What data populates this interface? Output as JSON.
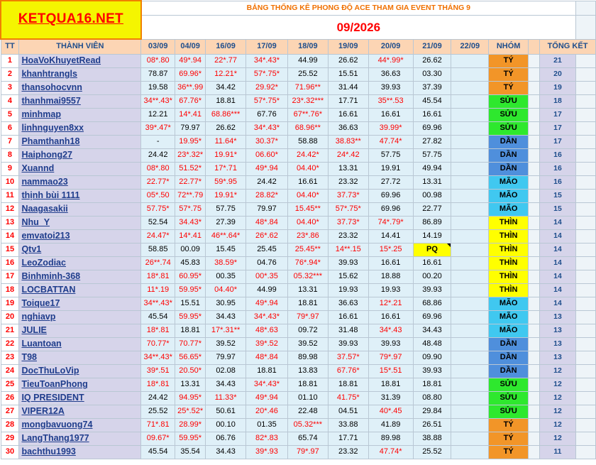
{
  "logo": "KETQUA16.NET",
  "title": "BẢNG THỐNG KÊ PHONG ĐỘ ACE THAM GIA EVENT THÁNG 9",
  "period": "09/2026",
  "headers": {
    "tt": "TT",
    "member": "THÀNH VIÊN",
    "dates": [
      "03/09",
      "04/09",
      "16/09",
      "17/09",
      "18/09",
      "19/09",
      "20/09",
      "21/09",
      "22/09"
    ],
    "group": "NHÓM",
    "total": "TỔNG KẾT"
  },
  "group_colors": {
    "TÝ": "#f29528",
    "SỬU": "#2ee82e",
    "DẦN": "#4f8fdc",
    "MÃO": "#40c8f0",
    "THÌN": "#ffff00"
  },
  "rows": [
    {
      "tt": "1",
      "name": "HoaVoKhuyetRead",
      "vals": [
        "08*.80",
        "49*.94",
        "22*.77",
        "34*.43*",
        "44.99",
        "26.62",
        "44*.99*",
        "26.62",
        ""
      ],
      "group": "TÝ",
      "total": "21"
    },
    {
      "tt": "2",
      "name": "khanhtrangls",
      "vals": [
        "78.87",
        "69.96*",
        "12.21*",
        "57*.75*",
        "25.52",
        "15.51",
        "36.63",
        "03.30",
        ""
      ],
      "group": "TÝ",
      "total": "20"
    },
    {
      "tt": "3",
      "name": "thansohocvnn",
      "vals": [
        "19.58",
        "36**.99",
        "34.42",
        "29.92*",
        "71.96**",
        "31.44",
        "39.93",
        "37.39",
        ""
      ],
      "group": "TÝ",
      "total": "19"
    },
    {
      "tt": "4",
      "name": "thanhmai9557",
      "vals": [
        "34**.43*",
        "67.76*",
        "18.81",
        "57*.75*",
        "23*.32***",
        "17.71",
        "35**.53",
        "45.54",
        ""
      ],
      "group": "SỬU",
      "total": "18"
    },
    {
      "tt": "5",
      "name": "minhmap",
      "vals": [
        "12.21",
        "14*.41",
        "68.86***",
        "67.76",
        "67**.76*",
        "16.61",
        "16.61",
        "16.61",
        ""
      ],
      "group": "SỬU",
      "total": "17"
    },
    {
      "tt": "6",
      "name": "linhnguyen8xx",
      "vals": [
        "39*.47*",
        "79.97",
        "26.62",
        "34*.43*",
        "68.96**",
        "36.63",
        "39.99*",
        "69.96",
        ""
      ],
      "group": "SỬU",
      "total": "17"
    },
    {
      "tt": "7",
      "name": "Phamthanh18",
      "vals": [
        "-",
        "19.95*",
        "11.64*",
        "30.37*",
        "58.88",
        "38.83**",
        "47.74*",
        "27.82",
        ""
      ],
      "group": "DẦN",
      "total": "17"
    },
    {
      "tt": "8",
      "name": "Haiphong27",
      "vals": [
        "24.42",
        "23*.32*",
        "19.91*",
        "06.60*",
        "24.42*",
        "24*.42",
        "57.75",
        "57.75",
        ""
      ],
      "group": "DẦN",
      "total": "16"
    },
    {
      "tt": "9",
      "name": "Xuannd",
      "vals": [
        "08*.80",
        "51.52*",
        "17*.71",
        "49*.94",
        "04.40*",
        "13.31",
        "19.91",
        "49.94",
        ""
      ],
      "group": "DẦN",
      "total": "16"
    },
    {
      "tt": "10",
      "name": "nammao23",
      "vals": [
        "22.77*",
        "22.77*",
        "59*.95",
        "24.42",
        "16.61",
        "23.32",
        "27.72",
        "13.31",
        ""
      ],
      "group": "MÃO",
      "total": "16"
    },
    {
      "tt": "11",
      "name": "thịnh bùi 1111",
      "vals": [
        "05*.50",
        "72**.79",
        "19.91*",
        "28.82*",
        "04.40*",
        "37.73*",
        "69.96",
        "00.98",
        ""
      ],
      "group": "MÃO",
      "total": "15"
    },
    {
      "tt": "12",
      "name": "Naagasakii",
      "vals": [
        "57.75*",
        "57*.75",
        "57.75",
        "79.97",
        "15.45**",
        "57*.75*",
        "69.96",
        "22.77",
        ""
      ],
      "group": "MÃO",
      "total": "15"
    },
    {
      "tt": "13",
      "name": "Nhu_Y",
      "vals": [
        "52.54",
        "34.43*",
        "27.39",
        "48*.84",
        "04.40*",
        "37.73*",
        "74*.79*",
        "86.89",
        ""
      ],
      "group": "THÌN",
      "total": "14"
    },
    {
      "tt": "14",
      "name": "emvatoi213",
      "vals": [
        "24.47*",
        "14*.41",
        "46**.64*",
        "26*.62",
        "23*.86",
        "23.32",
        "14.41",
        "14.19",
        ""
      ],
      "group": "THÌN",
      "total": "14"
    },
    {
      "tt": "15",
      "name": "Qtv1",
      "vals": [
        "58.85",
        "00.09",
        "15.45",
        "25.45",
        "25.45**",
        "14**.15",
        "15*.25",
        "PQ",
        ""
      ],
      "group": "THÌN",
      "total": "14"
    },
    {
      "tt": "16",
      "name": "LeoZodiac",
      "vals": [
        "26**.74",
        "45.83",
        "38.59*",
        "04.76",
        "76*.94*",
        "39.93",
        "16.61",
        "16.61",
        ""
      ],
      "group": "THÌN",
      "total": "14"
    },
    {
      "tt": "17",
      "name": "Binhminh-368",
      "vals": [
        "18*.81",
        "60.95*",
        "00.35",
        "00*.35",
        "05.32***",
        "15.62",
        "18.88",
        "00.20",
        ""
      ],
      "group": "THÌN",
      "total": "14"
    },
    {
      "tt": "18",
      "name": "LOCBATTAN",
      "vals": [
        "11*.19",
        "59.95*",
        "04.40*",
        "44.99",
        "13.31",
        "19.93",
        "19.93",
        "39.93",
        ""
      ],
      "group": "THÌN",
      "total": "14"
    },
    {
      "tt": "19",
      "name": "Toique17",
      "vals": [
        "34**.43*",
        "15.51",
        "30.95",
        "49*.94",
        "18.81",
        "36.63",
        "12*.21",
        "68.86",
        ""
      ],
      "group": "MÃO",
      "total": "14"
    },
    {
      "tt": "20",
      "name": "nghiavp",
      "vals": [
        "45.54",
        "59.95*",
        "34.43",
        "34*.43*",
        "79*.97",
        "16.61",
        "16.61",
        "69.96",
        ""
      ],
      "group": "MÃO",
      "total": "13"
    },
    {
      "tt": "21",
      "name": "JULIE",
      "vals": [
        "18*.81",
        "18.81",
        "17*.31**",
        "48*.63",
        "09.72",
        "31.48",
        "34*.43",
        "34.43",
        ""
      ],
      "group": "MÃO",
      "total": "13"
    },
    {
      "tt": "22",
      "name": "Luantoan",
      "vals": [
        "70.77*",
        "70.77*",
        "39.52",
        "39*.52",
        "39.52",
        "39.93",
        "39.93",
        "48.48",
        ""
      ],
      "group": "DẦN",
      "total": "13"
    },
    {
      "tt": "23",
      "name": "T98",
      "vals": [
        "34**.43*",
        "56.65*",
        "79.97",
        "48*.84",
        "89.98",
        "37.57*",
        "79*.97",
        "09.90",
        ""
      ],
      "group": "DẦN",
      "total": "13"
    },
    {
      "tt": "24",
      "name": "DocThuLoVip",
      "vals": [
        "39*.51",
        "20.50*",
        "02.08",
        "18.81",
        "13.83",
        "67.76*",
        "15*.51",
        "39.93",
        ""
      ],
      "group": "DẦN",
      "total": "12"
    },
    {
      "tt": "25",
      "name": "TieuToanPhong",
      "vals": [
        "18*.81",
        "13.31",
        "34.43",
        "34*.43*",
        "18.81",
        "18.81",
        "18.81",
        "18.81",
        ""
      ],
      "group": "SỬU",
      "total": "12"
    },
    {
      "tt": "26",
      "name": "IQ PRESIDENT",
      "vals": [
        "24.42",
        "94.95*",
        "11.33*",
        "49*.94",
        "01.10",
        "41.75*",
        "31.39",
        "08.80",
        ""
      ],
      "group": "SỬU",
      "total": "12"
    },
    {
      "tt": "27",
      "name": "VIPER12A",
      "vals": [
        "25.52",
        "25*.52*",
        "50.61",
        "20*.46",
        "22.48",
        "04.51",
        "40*.45",
        "29.84",
        ""
      ],
      "group": "SỬU",
      "total": "12"
    },
    {
      "tt": "28",
      "name": "mongbavuong74",
      "vals": [
        "71*.81",
        "28.99*",
        "00.10",
        "01.35",
        "05.32***",
        "33.88",
        "41.89",
        "26.51",
        ""
      ],
      "group": "TÝ",
      "total": "12"
    },
    {
      "tt": "29",
      "name": "LangThang1977",
      "vals": [
        "09.67*",
        "59.95*",
        "06.76",
        "82*.83",
        "65.74",
        "17.71",
        "89.98",
        "38.88",
        ""
      ],
      "group": "TÝ",
      "total": "12"
    },
    {
      "tt": "30",
      "name": "bachthu1993",
      "vals": [
        "45.54",
        "35.54",
        "34.43",
        "39*.93",
        "79*.97",
        "23.32",
        "47.74*",
        "25.52",
        ""
      ],
      "group": "TÝ",
      "total": "11"
    }
  ]
}
